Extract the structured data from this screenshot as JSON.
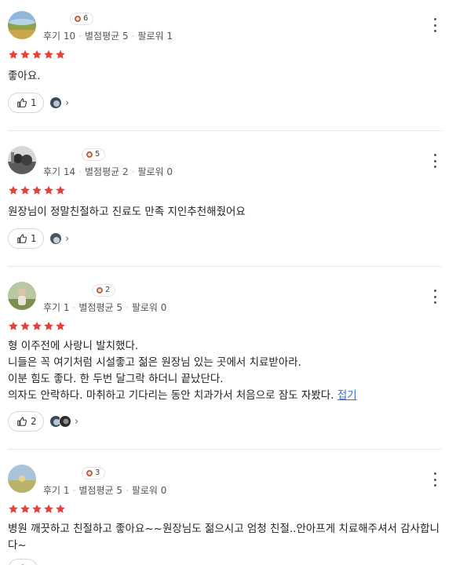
{
  "reviews": [
    {
      "badge_count": "6",
      "stats": {
        "reviews": "후기 10",
        "rating": "별점평균 5",
        "followers": "팔로워 1"
      },
      "star_color": "#e5413b",
      "text": "좋아요.",
      "collapse_label": "",
      "likes": "1"
    },
    {
      "badge_count": "5",
      "stats": {
        "reviews": "후기 14",
        "rating": "별점평균 2",
        "followers": "팔로워 0"
      },
      "star_color": "#e5413b",
      "text": "원장님이 정말친절하고 진료도 만족 지인추천해줬어요",
      "collapse_label": "",
      "likes": "1"
    },
    {
      "badge_count": "2",
      "stats": {
        "reviews": "후기 1",
        "rating": "별점평균 5",
        "followers": "팔로워 0"
      },
      "star_color": "#e5413b",
      "text": "형 이주전에 사랑니 발치했다.\n니들은 꼭 여기처럼 시설좋고 젊은 원장님 있는 곳에서 치료받아라.\n이분 힘도 좋다. 한 두번 달그락 하더니 끝났단다.\n의자도 안락하다. 마취하고 기다리는 동안 치과가서 처음으로 잠도 자봤다. ",
      "collapse_label": "접기",
      "likes": "2"
    },
    {
      "badge_count": "3",
      "stats": {
        "reviews": "후기 1",
        "rating": "별점평균 5",
        "followers": "팔로워 0"
      },
      "star_color": "#e5413b",
      "text": "병원 깨끗하고 친절하고 좋아요~~원장님도 젊으시고 엄청 친절..안아프게 치료해주셔서 감사합니다~",
      "collapse_label": "",
      "likes": ""
    }
  ],
  "icons": {
    "badge": "level-badge-icon",
    "kebab": "more-options-icon",
    "thumb": "thumbs-up-icon",
    "chevron": "chevron-right-icon",
    "star": "star-icon"
  }
}
